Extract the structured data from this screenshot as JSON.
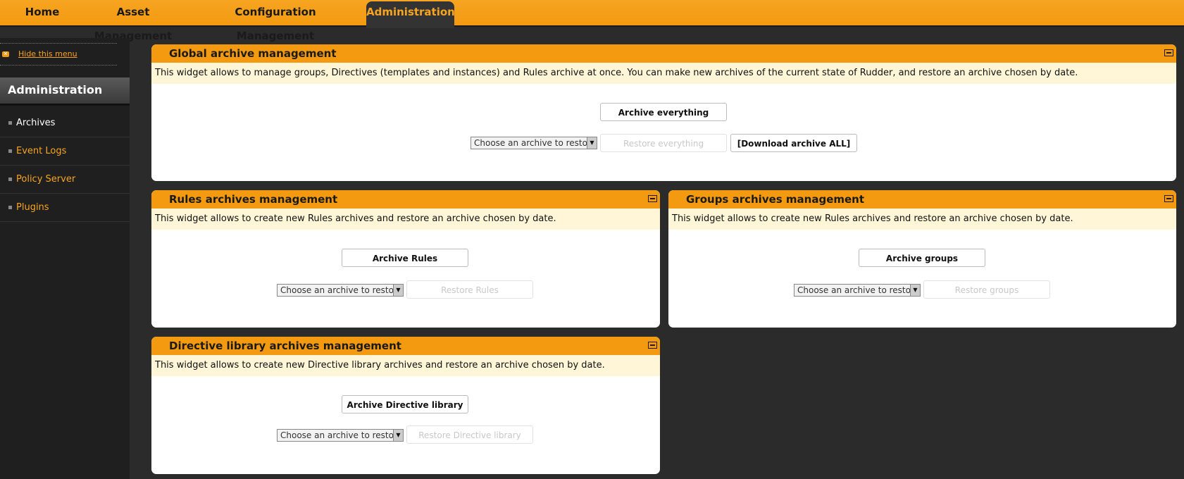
{
  "nav": {
    "items": [
      {
        "label": "Home"
      },
      {
        "label": "Asset Management"
      },
      {
        "label": "Configuration Management"
      },
      {
        "label": "Administration"
      }
    ]
  },
  "sidebar": {
    "hide_label": "Hide this menu",
    "title": "Administration",
    "items": [
      {
        "label": "Archives"
      },
      {
        "label": "Event Logs"
      },
      {
        "label": "Policy Server"
      },
      {
        "label": "Plugins"
      }
    ]
  },
  "global": {
    "title": "Global archive management",
    "description": "This widget allows to manage groups, Directives (templates and instances) and Rules archive at once. You can make new archives of the current state of Rudder, and restore an archive chosen by date.",
    "archive_label": "Archive everything",
    "select_value": "Choose an archive to restore.",
    "restore_label": "Restore everything",
    "download_label": "[Download archive ALL]"
  },
  "rules": {
    "title": "Rules archives management",
    "description": "This widget allows to create new Rules archives and restore an archive chosen by date.",
    "archive_label": "Archive Rules",
    "select_value": "Choose an archive to restore.",
    "restore_label": "Restore Rules"
  },
  "groups": {
    "title": "Groups archives management",
    "description": "This widget allows to create new Rules archives and restore an archive chosen by date.",
    "archive_label": "Archive groups",
    "select_value": "Choose an archive to restore.",
    "restore_label": "Restore groups"
  },
  "directives": {
    "title": "Directive library archives management",
    "description": "This widget allows to create new Directive library archives and restore an archive chosen by date.",
    "archive_label": "Archive Directive library",
    "select_value": "Choose an archive to restore.",
    "restore_label": "Restore Directive library"
  },
  "colors": {
    "accent": "#f39a10",
    "background": "#2b2b2b",
    "description_bg": "#fef6d6"
  }
}
